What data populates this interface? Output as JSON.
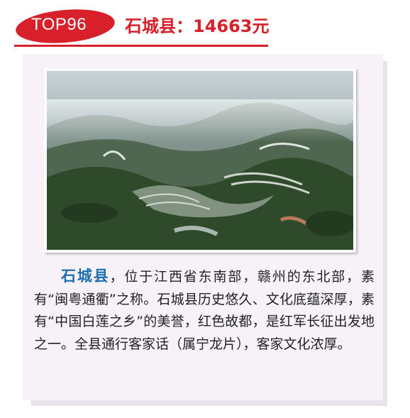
{
  "header": {
    "rank_label": "TOP96",
    "title": "石城县：14663元",
    "accent_color": "#d8202a"
  },
  "photo": {
    "subject": "aerial view of terraced fields in misty mountains",
    "icon": "landscape-photo"
  },
  "description": {
    "place_name": "石城县",
    "body": "，位于江西省东南部，赣州的东北部，素有“闽粤通衢”之称。石城县历史悠久、文化底蕴深厚，素有“中国白莲之乡”的美誉，红色故都，是红军长征出发地之一。全县通行客家话（属宁龙片），客家文化浓厚。",
    "place_color": "#1f6fb0"
  }
}
